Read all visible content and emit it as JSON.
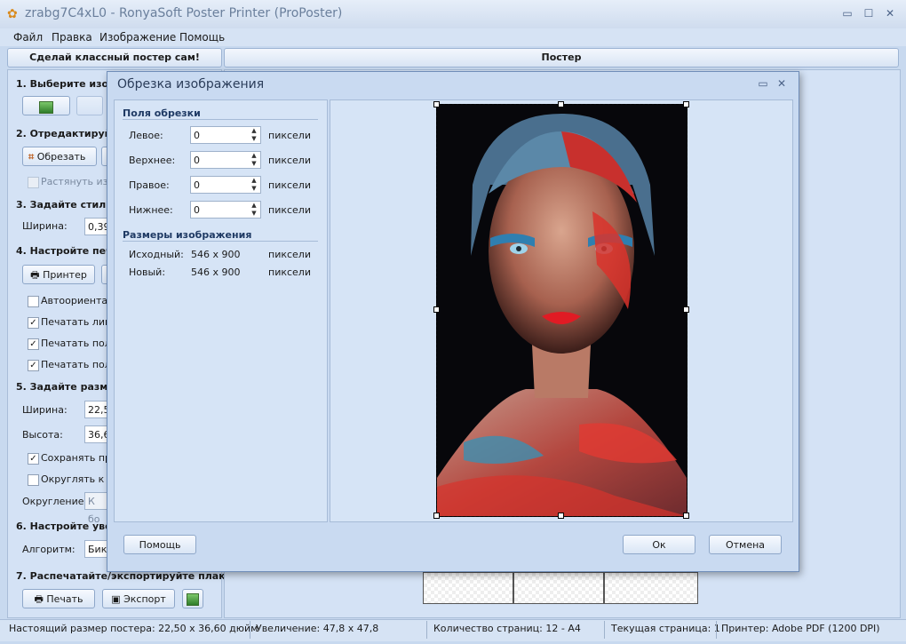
{
  "window": {
    "title": "zrabg7C4xL0 - RonyaSoft Poster Printer (ProPoster)",
    "controls": [
      "▭",
      "☐",
      "✕"
    ]
  },
  "menu": [
    "Файл",
    "Правка",
    "Изображение",
    "Помощь"
  ],
  "tabs": {
    "left": "Сделай классный постер сам!",
    "right": "Постер"
  },
  "left_panel": {
    "s1": "1. Выберите изоб",
    "s2": "2. Отредактируйт",
    "crop_button": "Обрезать",
    "stretch": "Растянуть изо",
    "s3": "3. Задайте стиль",
    "width_label": "Ширина:",
    "width_value": "0,39",
    "s4": "4. Настройте печа",
    "printer_button": "Принтер",
    "auto_orient": "Автоориентац",
    "print_lines": "Печатать лини",
    "print_fields1": "Печатать поля",
    "print_fields2": "Печатать поля",
    "s5": "5. Задайте разме",
    "size_width_label": "Ширина:",
    "size_width_value": "22,5",
    "size_height_label": "Высота:",
    "size_height_value": "36,6",
    "keep_prop": "Сохранять про",
    "round_to": "Округлять к р",
    "rounding_label": "Округление:",
    "rounding_value": "К бо",
    "s6": "6. Настройте увел",
    "algo_label": "Алгоритм:",
    "algo_value": "Бику",
    "s7": "7. Распечатайте/экспортируйте плак",
    "print_button": "Печать",
    "export_button": "Экспорт"
  },
  "status": {
    "real_size": "Настоящий размер постера: 22,50 x 36,60 дюйм",
    "zoom": "Увеличение: 47,8 x 47,8",
    "pages": "Количество страниц: 12 - A4",
    "current_page": "Текущая страница: 1",
    "printer": "Принтер: Adobe PDF (1200 DPI)"
  },
  "dialog": {
    "title": "Обрезка изображения",
    "group_margins": "Поля обрезки",
    "left_label": "Левое:",
    "left_value": "0",
    "top_label": "Верхнее:",
    "top_value": "0",
    "right_label": "Правое:",
    "right_value": "0",
    "bottom_label": "Нижнее:",
    "bottom_value": "0",
    "unit": "пиксели",
    "group_sizes": "Размеры изображения",
    "orig_label": "Исходный:",
    "orig_value": "546 x 900",
    "new_label": "Новый:",
    "new_value": "546 x 900",
    "help_button": "Помощь",
    "ok_button": "Ок",
    "cancel_button": "Отмена"
  }
}
